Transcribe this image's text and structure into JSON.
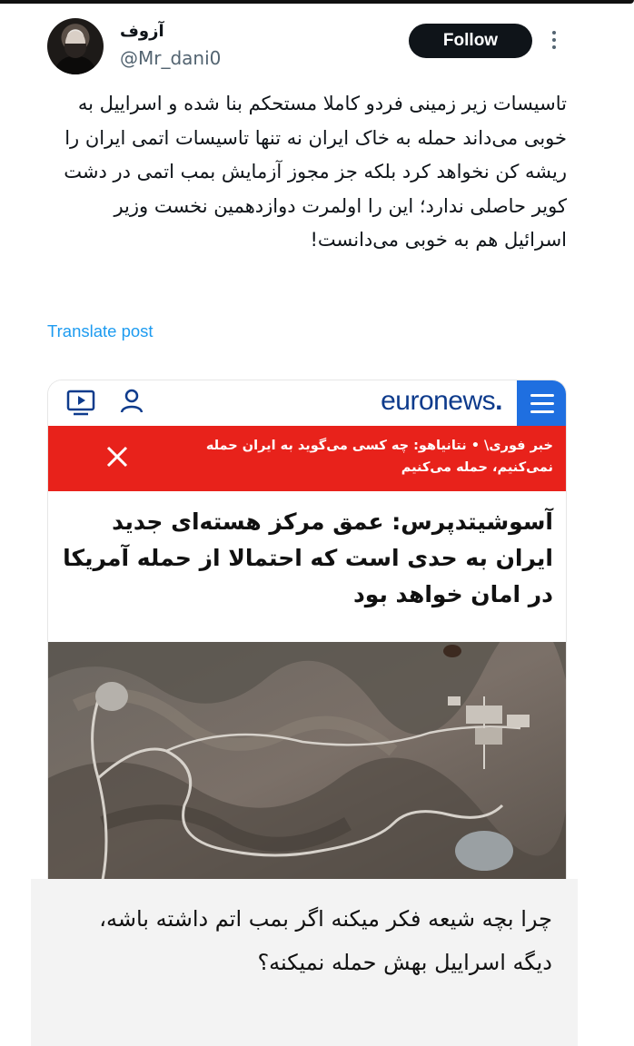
{
  "author": {
    "display_name": "آزوف",
    "handle": "@Mr_dani0"
  },
  "actions": {
    "follow_label": "Follow",
    "more_icon": "more-options-icon"
  },
  "tweet": {
    "text": "تاسیسات زیر زمینی فردو کاملا مستحکم بنا شده و اسراییل به خوبی می‌داند حمله به خاک ایران نه تنها تاسیسات اتمی ایران را ریشه کن نخواهد کرد بلکه جز مجوز آزمایش بمب اتمی در دشت کویر حاصلی ندارد؛ این را اولمرت دوازدهمین نخست وزیر اسرائیل هم به خوبی می‌دانست!",
    "translate_label": "Translate post"
  },
  "embed": {
    "logo_text": "euronews",
    "logo_dot": ".",
    "breaking_text": "خبر فوری\\ • نتانیاهو: چه کسی می‌گوید به ایران حمله نمی‌کنیم، حمله می‌کنیم",
    "headline": "آسوشیتدپرس: عمق مرکز هسته‌ای جدید ایران به حدی است که احتمالا از حمله آمریکا در امان خواهد بود",
    "colors": {
      "brand_blue": "#0e3b8c",
      "menu_blue": "#1f6fe0",
      "breaking_red": "#e8221b"
    }
  },
  "caption": {
    "text": "چرا بچه شیعه فکر میکنه اگر بمب اتم داشته باشه، دیگه اسراییل بهش حمله نمیکنه؟"
  }
}
